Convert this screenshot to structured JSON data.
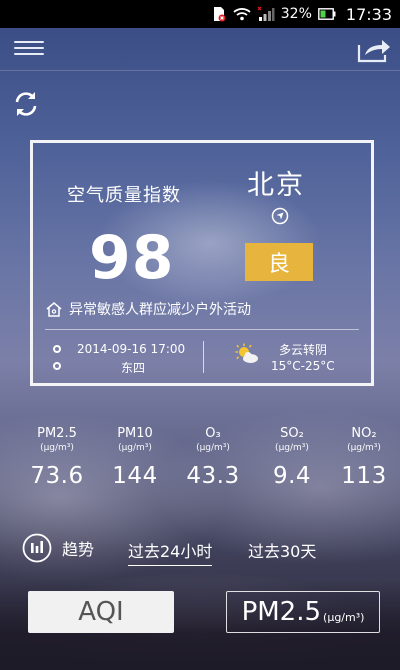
{
  "status_bar": {
    "battery_percent": "32%",
    "time": "17:33",
    "icons": [
      "sim-card-error-icon",
      "wifi-icon",
      "signal-icon",
      "battery-icon"
    ]
  },
  "header": {
    "icons": [
      "menu-icon",
      "share-icon",
      "refresh-icon"
    ]
  },
  "aqi_card": {
    "title": "空气质量指数",
    "value": "98",
    "city": "北京",
    "level": "良",
    "level_color": "#e7b43d",
    "advice": "异常敏感人群应减少户外活动",
    "datetime": "2014-09-16 17:00",
    "station": "东四",
    "weather_desc": "多云转阴",
    "temperature": "15°C-25°C",
    "icons": [
      "location-arrow-icon",
      "home-icon",
      "clock-icon",
      "pin-icon",
      "partly-cloudy-icon"
    ]
  },
  "pollutants": [
    {
      "name": "PM2.5",
      "unit": "(μg/m³)",
      "value": "73.6"
    },
    {
      "name": "PM10",
      "unit": "(μg/m³)",
      "value": "144"
    },
    {
      "name": "O₃",
      "unit": "(μg/m³)",
      "value": "43.3"
    },
    {
      "name": "SO₂",
      "unit": "(μg/m³)",
      "value": "9.4"
    },
    {
      "name": "NO₂",
      "unit": "(μg/m³)",
      "value": "113"
    }
  ],
  "trend": {
    "label": "趋势",
    "tabs": [
      "过去24小时",
      "过去30天"
    ],
    "selected_tab": "过去24小时"
  },
  "bottom_buttons": {
    "aqi": "AQI",
    "pm_name": "PM2.5",
    "pm_unit": "(μg/m³)",
    "selected": "AQI"
  }
}
